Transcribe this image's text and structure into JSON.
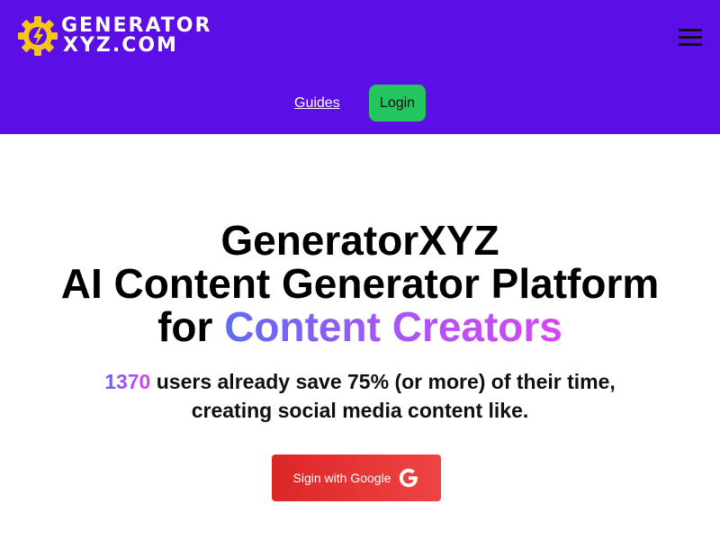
{
  "colors": {
    "header_bg": "#5b0fe6",
    "login_bg": "#22c55e",
    "signin_bg": "#ef4444",
    "accent_gradient_start": "#5b6cf2",
    "accent_gradient_end": "#d946ef",
    "logo_gear": "#f5c518"
  },
  "header": {
    "logo": {
      "line1": "GENERATOR",
      "line2": "XYZ.COM",
      "icon": "gear-bolt-icon"
    },
    "menu_icon": "hamburger-menu-icon",
    "nav": {
      "guides_label": "Guides",
      "login_label": "Login"
    }
  },
  "hero": {
    "title_line1": "GeneratorXYZ",
    "title_line2": "AI Content Generator Platform",
    "title_line3_prefix": "for ",
    "title_line3_highlight": "Content Creators",
    "user_count": "1370",
    "subtitle_rest": " users already save 75% (or more) of their time,",
    "subtitle_line2": "creating social media content like.",
    "signin_label": "Sigin with Google",
    "signin_icon": "google-g-icon"
  }
}
